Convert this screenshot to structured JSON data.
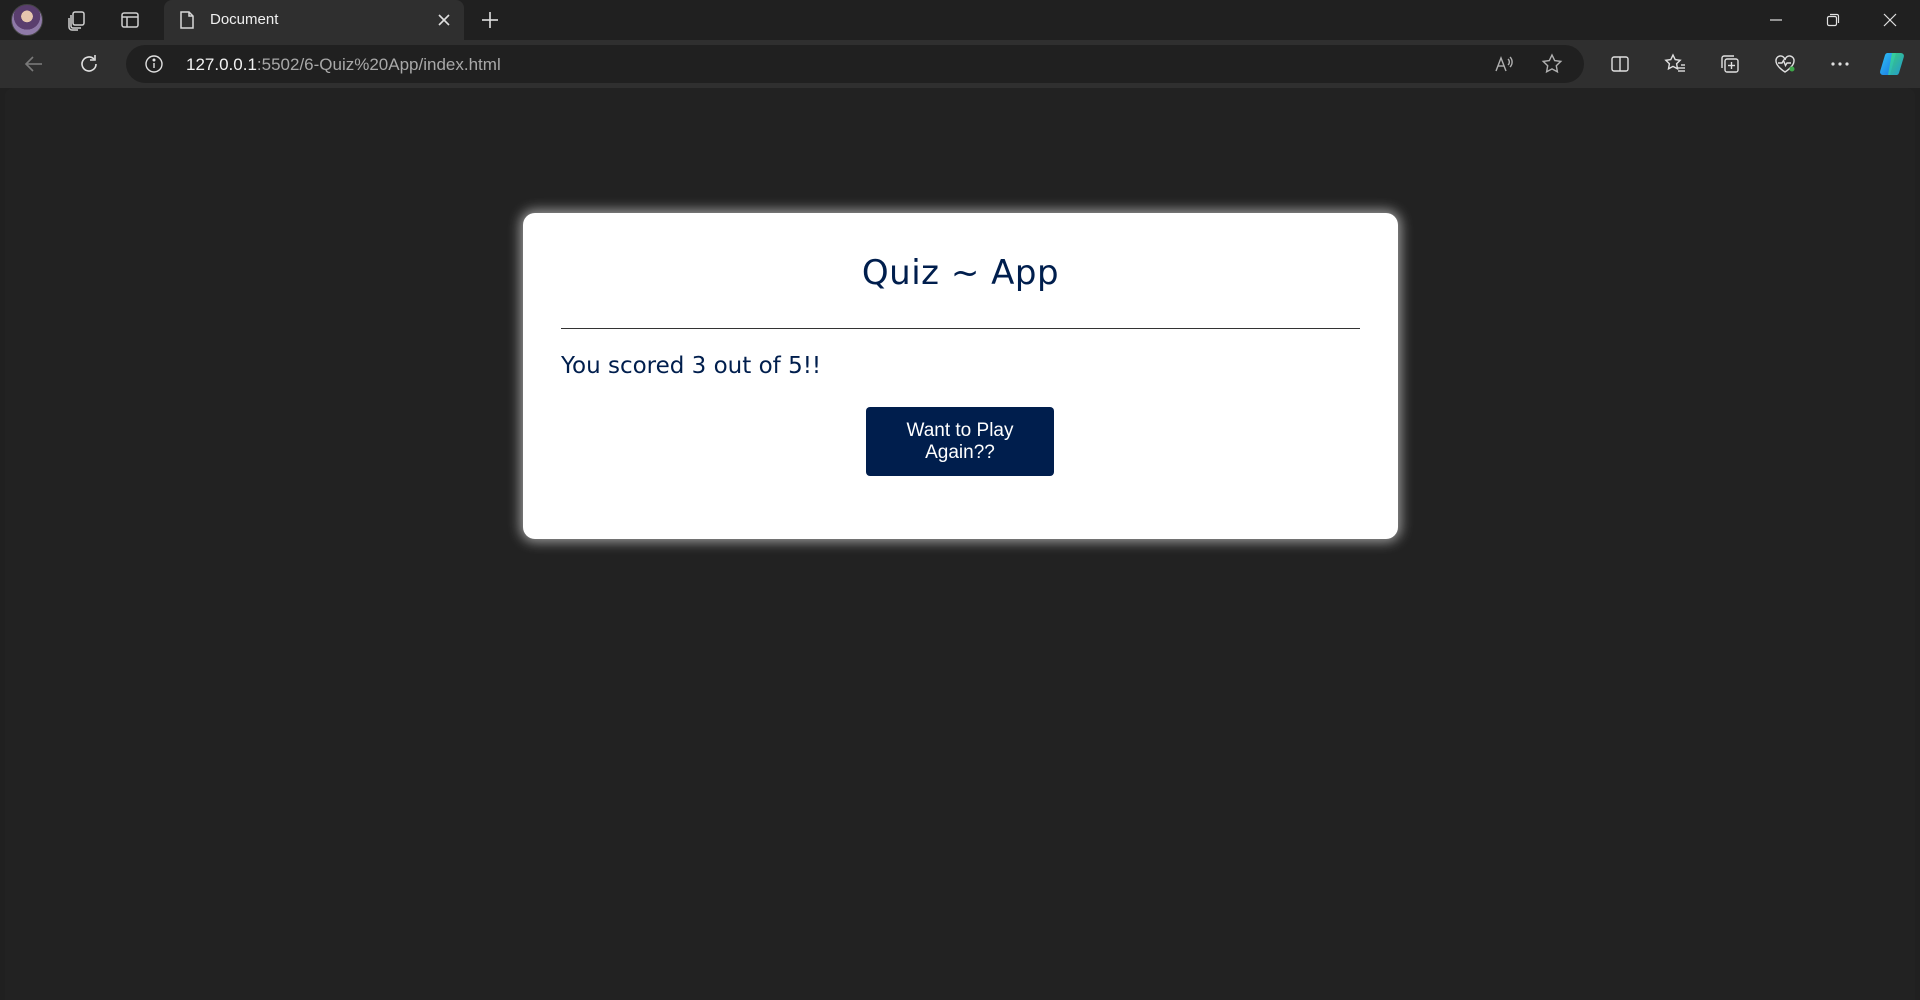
{
  "browser": {
    "tab": {
      "title": "Document"
    },
    "address": {
      "host": "127.0.0.1",
      "rest": ":5502/6-Quiz%20App/index.html"
    },
    "icons": {
      "profile": "profile-avatar",
      "workspaces": "workspaces-icon",
      "tab_actions": "tab-actions-icon",
      "doc": "document-icon",
      "close": "close-icon",
      "new_tab": "plus-icon",
      "back": "back-arrow-icon",
      "refresh": "refresh-icon",
      "info": "info-icon",
      "read_aloud": "read-aloud-icon",
      "favorite": "star-icon",
      "split": "split-screen-icon",
      "favorites": "favorites-icon",
      "collections": "collections-icon",
      "health": "browser-essentials-icon",
      "more": "more-icon",
      "copilot": "copilot-icon"
    }
  },
  "quiz": {
    "title": "Quiz ~ App",
    "score_text": "You scored 3 out of 5!!",
    "button_label": "Want to Play Again??"
  },
  "colors": {
    "page_bg": "#222222",
    "card_bg": "#ffffff",
    "accent": "#001e4d"
  }
}
